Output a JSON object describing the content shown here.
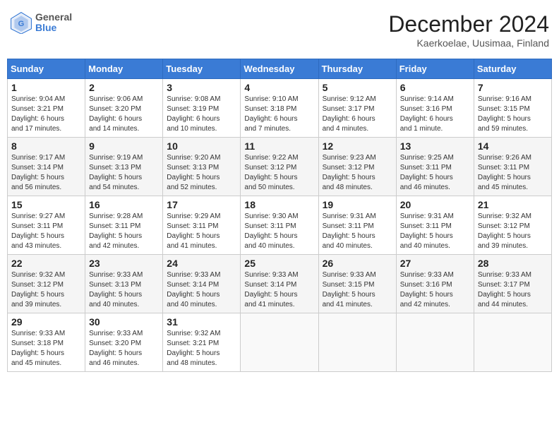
{
  "logo": {
    "line1": "General",
    "line2": "Blue"
  },
  "title": "December 2024",
  "subtitle": "Kaerkoelae, Uusimaa, Finland",
  "days_of_week": [
    "Sunday",
    "Monday",
    "Tuesday",
    "Wednesday",
    "Thursday",
    "Friday",
    "Saturday"
  ],
  "weeks": [
    [
      {
        "day": "1",
        "info": "Sunrise: 9:04 AM\nSunset: 3:21 PM\nDaylight: 6 hours\nand 17 minutes."
      },
      {
        "day": "2",
        "info": "Sunrise: 9:06 AM\nSunset: 3:20 PM\nDaylight: 6 hours\nand 14 minutes."
      },
      {
        "day": "3",
        "info": "Sunrise: 9:08 AM\nSunset: 3:19 PM\nDaylight: 6 hours\nand 10 minutes."
      },
      {
        "day": "4",
        "info": "Sunrise: 9:10 AM\nSunset: 3:18 PM\nDaylight: 6 hours\nand 7 minutes."
      },
      {
        "day": "5",
        "info": "Sunrise: 9:12 AM\nSunset: 3:17 PM\nDaylight: 6 hours\nand 4 minutes."
      },
      {
        "day": "6",
        "info": "Sunrise: 9:14 AM\nSunset: 3:16 PM\nDaylight: 6 hours\nand 1 minute."
      },
      {
        "day": "7",
        "info": "Sunrise: 9:16 AM\nSunset: 3:15 PM\nDaylight: 5 hours\nand 59 minutes."
      }
    ],
    [
      {
        "day": "8",
        "info": "Sunrise: 9:17 AM\nSunset: 3:14 PM\nDaylight: 5 hours\nand 56 minutes."
      },
      {
        "day": "9",
        "info": "Sunrise: 9:19 AM\nSunset: 3:13 PM\nDaylight: 5 hours\nand 54 minutes."
      },
      {
        "day": "10",
        "info": "Sunrise: 9:20 AM\nSunset: 3:13 PM\nDaylight: 5 hours\nand 52 minutes."
      },
      {
        "day": "11",
        "info": "Sunrise: 9:22 AM\nSunset: 3:12 PM\nDaylight: 5 hours\nand 50 minutes."
      },
      {
        "day": "12",
        "info": "Sunrise: 9:23 AM\nSunset: 3:12 PM\nDaylight: 5 hours\nand 48 minutes."
      },
      {
        "day": "13",
        "info": "Sunrise: 9:25 AM\nSunset: 3:11 PM\nDaylight: 5 hours\nand 46 minutes."
      },
      {
        "day": "14",
        "info": "Sunrise: 9:26 AM\nSunset: 3:11 PM\nDaylight: 5 hours\nand 45 minutes."
      }
    ],
    [
      {
        "day": "15",
        "info": "Sunrise: 9:27 AM\nSunset: 3:11 PM\nDaylight: 5 hours\nand 43 minutes."
      },
      {
        "day": "16",
        "info": "Sunrise: 9:28 AM\nSunset: 3:11 PM\nDaylight: 5 hours\nand 42 minutes."
      },
      {
        "day": "17",
        "info": "Sunrise: 9:29 AM\nSunset: 3:11 PM\nDaylight: 5 hours\nand 41 minutes."
      },
      {
        "day": "18",
        "info": "Sunrise: 9:30 AM\nSunset: 3:11 PM\nDaylight: 5 hours\nand 40 minutes."
      },
      {
        "day": "19",
        "info": "Sunrise: 9:31 AM\nSunset: 3:11 PM\nDaylight: 5 hours\nand 40 minutes."
      },
      {
        "day": "20",
        "info": "Sunrise: 9:31 AM\nSunset: 3:11 PM\nDaylight: 5 hours\nand 40 minutes."
      },
      {
        "day": "21",
        "info": "Sunrise: 9:32 AM\nSunset: 3:12 PM\nDaylight: 5 hours\nand 39 minutes."
      }
    ],
    [
      {
        "day": "22",
        "info": "Sunrise: 9:32 AM\nSunset: 3:12 PM\nDaylight: 5 hours\nand 39 minutes."
      },
      {
        "day": "23",
        "info": "Sunrise: 9:33 AM\nSunset: 3:13 PM\nDaylight: 5 hours\nand 40 minutes."
      },
      {
        "day": "24",
        "info": "Sunrise: 9:33 AM\nSunset: 3:14 PM\nDaylight: 5 hours\nand 40 minutes."
      },
      {
        "day": "25",
        "info": "Sunrise: 9:33 AM\nSunset: 3:14 PM\nDaylight: 5 hours\nand 41 minutes."
      },
      {
        "day": "26",
        "info": "Sunrise: 9:33 AM\nSunset: 3:15 PM\nDaylight: 5 hours\nand 41 minutes."
      },
      {
        "day": "27",
        "info": "Sunrise: 9:33 AM\nSunset: 3:16 PM\nDaylight: 5 hours\nand 42 minutes."
      },
      {
        "day": "28",
        "info": "Sunrise: 9:33 AM\nSunset: 3:17 PM\nDaylight: 5 hours\nand 44 minutes."
      }
    ],
    [
      {
        "day": "29",
        "info": "Sunrise: 9:33 AM\nSunset: 3:18 PM\nDaylight: 5 hours\nand 45 minutes."
      },
      {
        "day": "30",
        "info": "Sunrise: 9:33 AM\nSunset: 3:20 PM\nDaylight: 5 hours\nand 46 minutes."
      },
      {
        "day": "31",
        "info": "Sunrise: 9:32 AM\nSunset: 3:21 PM\nDaylight: 5 hours\nand 48 minutes."
      },
      {
        "day": "",
        "info": ""
      },
      {
        "day": "",
        "info": ""
      },
      {
        "day": "",
        "info": ""
      },
      {
        "day": "",
        "info": ""
      }
    ]
  ]
}
